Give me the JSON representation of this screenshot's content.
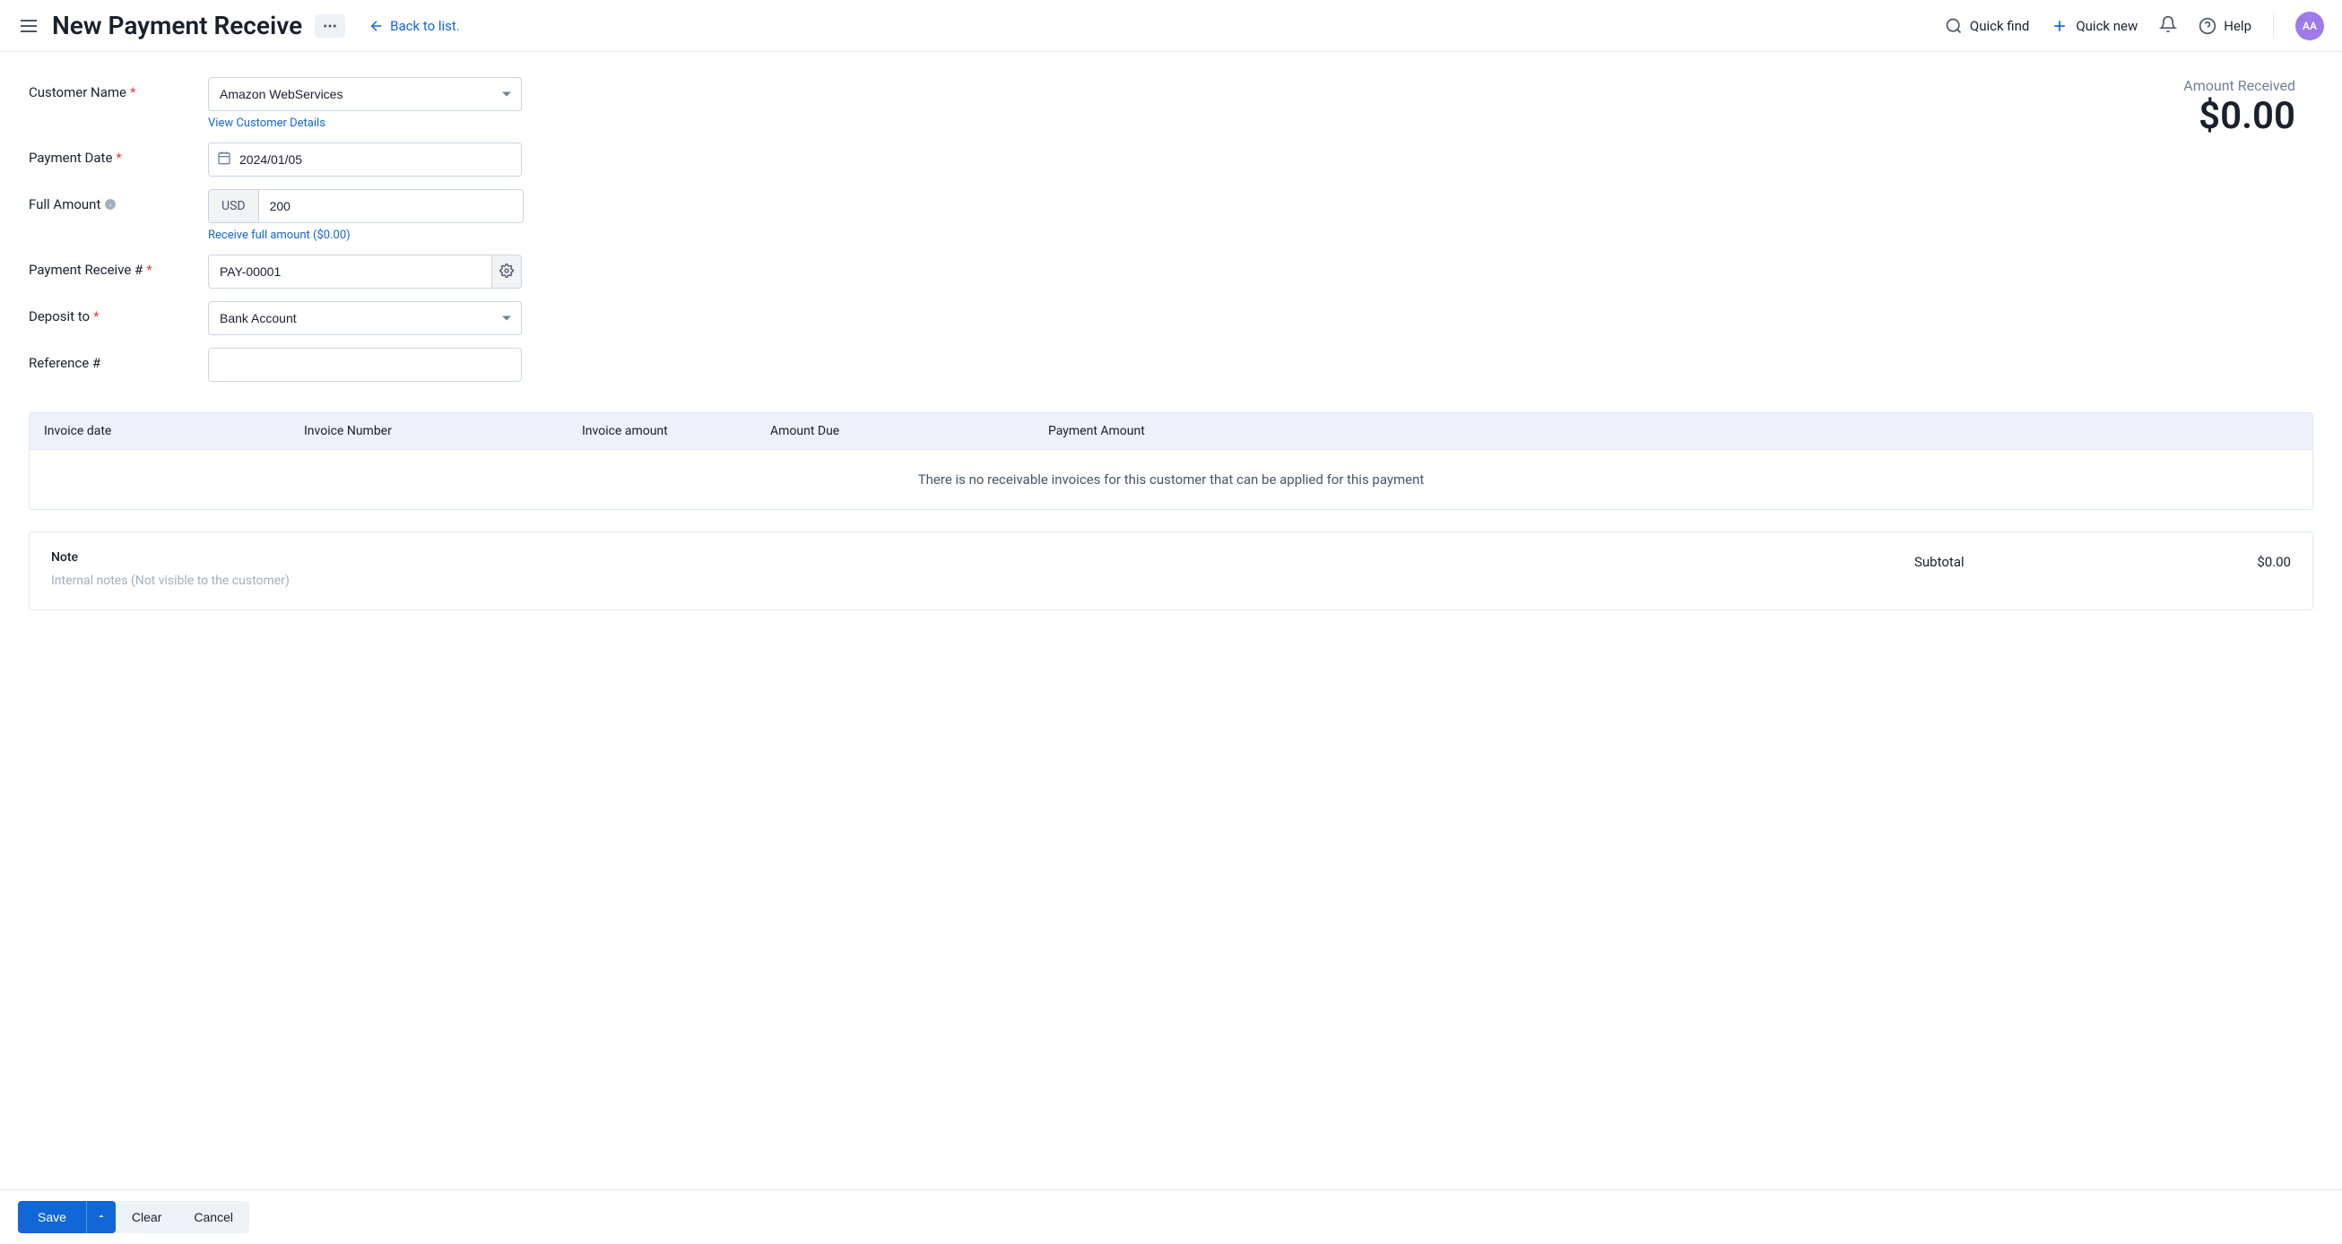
{
  "header": {
    "title": "New Payment Receive",
    "back_link": "Back to list.",
    "quick_find": "Quick find",
    "quick_new": "Quick new",
    "help": "Help",
    "avatar_initials": "AA"
  },
  "form": {
    "customer_name": {
      "label": "Customer Name",
      "value": "Amazon WebServices",
      "view_details": "View Customer Details"
    },
    "payment_date": {
      "label": "Payment Date",
      "value": "2024/01/05"
    },
    "full_amount": {
      "label": "Full Amount",
      "currency": "USD",
      "value": "200",
      "receive_full_link": "Receive full amount ($0.00)"
    },
    "payment_receive_no": {
      "label": "Payment Receive #",
      "value": "PAY-00001"
    },
    "deposit_to": {
      "label": "Deposit to",
      "value": "Bank Account"
    },
    "reference_no": {
      "label": "Reference #",
      "value": ""
    }
  },
  "amount_received": {
    "label": "Amount Received",
    "value": "$0.00"
  },
  "invoice_table": {
    "headers": {
      "date": "Invoice date",
      "number": "Invoice Number",
      "amount": "Invoice amount",
      "due": "Amount Due",
      "payment": "Payment Amount"
    },
    "empty_message": "There is no receivable invoices for this customer that can be applied for this payment"
  },
  "note": {
    "title": "Note",
    "placeholder": "Internal notes (Not visible to the customer)"
  },
  "totals": {
    "subtotal_label": "Subtotal",
    "subtotal_value": "$0.00"
  },
  "footer": {
    "save": "Save",
    "clear": "Clear",
    "cancel": "Cancel"
  }
}
